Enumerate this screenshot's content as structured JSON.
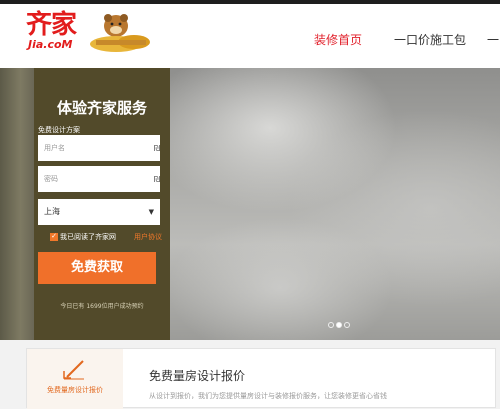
{
  "brand": {
    "logo_cn": "齐家",
    "logo_en": "Jia.coM"
  },
  "nav": {
    "items": [
      {
        "label": "装修首页",
        "active": true
      },
      {
        "label": "一口价施工包",
        "active": false
      },
      {
        "label": "一",
        "active": false
      }
    ]
  },
  "form": {
    "title": "体验齐家服务",
    "subtitle": "免费设计方案",
    "username_placeholder": "用户名",
    "password_placeholder": "密码",
    "city": "上海",
    "agree_text": "我已阅读了齐家网",
    "agree_link": "用户协议",
    "submit_label": "免费获取",
    "count_text": "今日已有 1699位用户成功预约"
  },
  "carousel": {
    "slides": 3,
    "active_index": 1
  },
  "service_card": {
    "tab_label": "免费量房设计报价",
    "title": "免费量房设计报价",
    "description": "从设计到报价，我们为您提供量房设计与装修报价服务，让您装修更省心省钱"
  },
  "colors": {
    "brand_red": "#e21c1c",
    "accent_orange": "#f0702a",
    "panel_olive": "#524a2a"
  }
}
